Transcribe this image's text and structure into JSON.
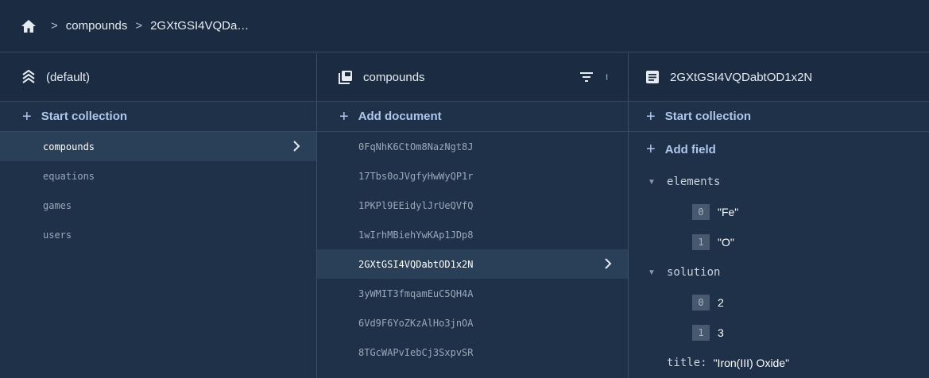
{
  "breadcrumb": {
    "items": [
      "compounds",
      "2GXtGSI4VQDa…"
    ]
  },
  "database_panel": {
    "title": "(default)",
    "action": "Start collection",
    "collections": [
      "compounds",
      "equations",
      "games",
      "users"
    ],
    "selected": "compounds"
  },
  "collection_panel": {
    "title": "compounds",
    "action": "Add document",
    "documents": [
      "0FqNhK6CtOm8NazNgt8J",
      "17Tbs0oJVgfyHwWyQP1r",
      "1PKPl9EEidylJrUeQVfQ",
      "1wIrhMBiehYwKAp1JDp8",
      "2GXtGSI4VQDabtOD1x2N",
      "3yWMIT3fmqamEuC5QH4A",
      "6Vd9F6YoZKzAlHo3jnOA",
      "8TGcWAPvIebCj3SxpvSR"
    ],
    "selected": "2GXtGSI4VQDabtOD1x2N"
  },
  "document_panel": {
    "title": "2GXtGSI4VQDabtOD1x2N",
    "action": "Start collection",
    "add_field": "Add field",
    "elements": {
      "key": "elements",
      "items": [
        {
          "index": "0",
          "value": "\"Fe\""
        },
        {
          "index": "1",
          "value": "\"O\""
        }
      ]
    },
    "solution": {
      "key": "solution",
      "items": [
        {
          "index": "0",
          "value": "2"
        },
        {
          "index": "1",
          "value": "3"
        }
      ]
    },
    "title_field": {
      "key": "title:",
      "value": "\"Iron(III) Oxide\""
    }
  },
  "icons": {
    "home": "home-icon",
    "database": "database-icon",
    "collection": "collection-icon",
    "document": "document-icon",
    "filter": "filter-icon",
    "menu": "more-vert-icon"
  },
  "colors": {
    "background": "#1e3149",
    "header": "#1a2b42",
    "accent": "#aec7ec",
    "selected": "#2a3f58"
  }
}
